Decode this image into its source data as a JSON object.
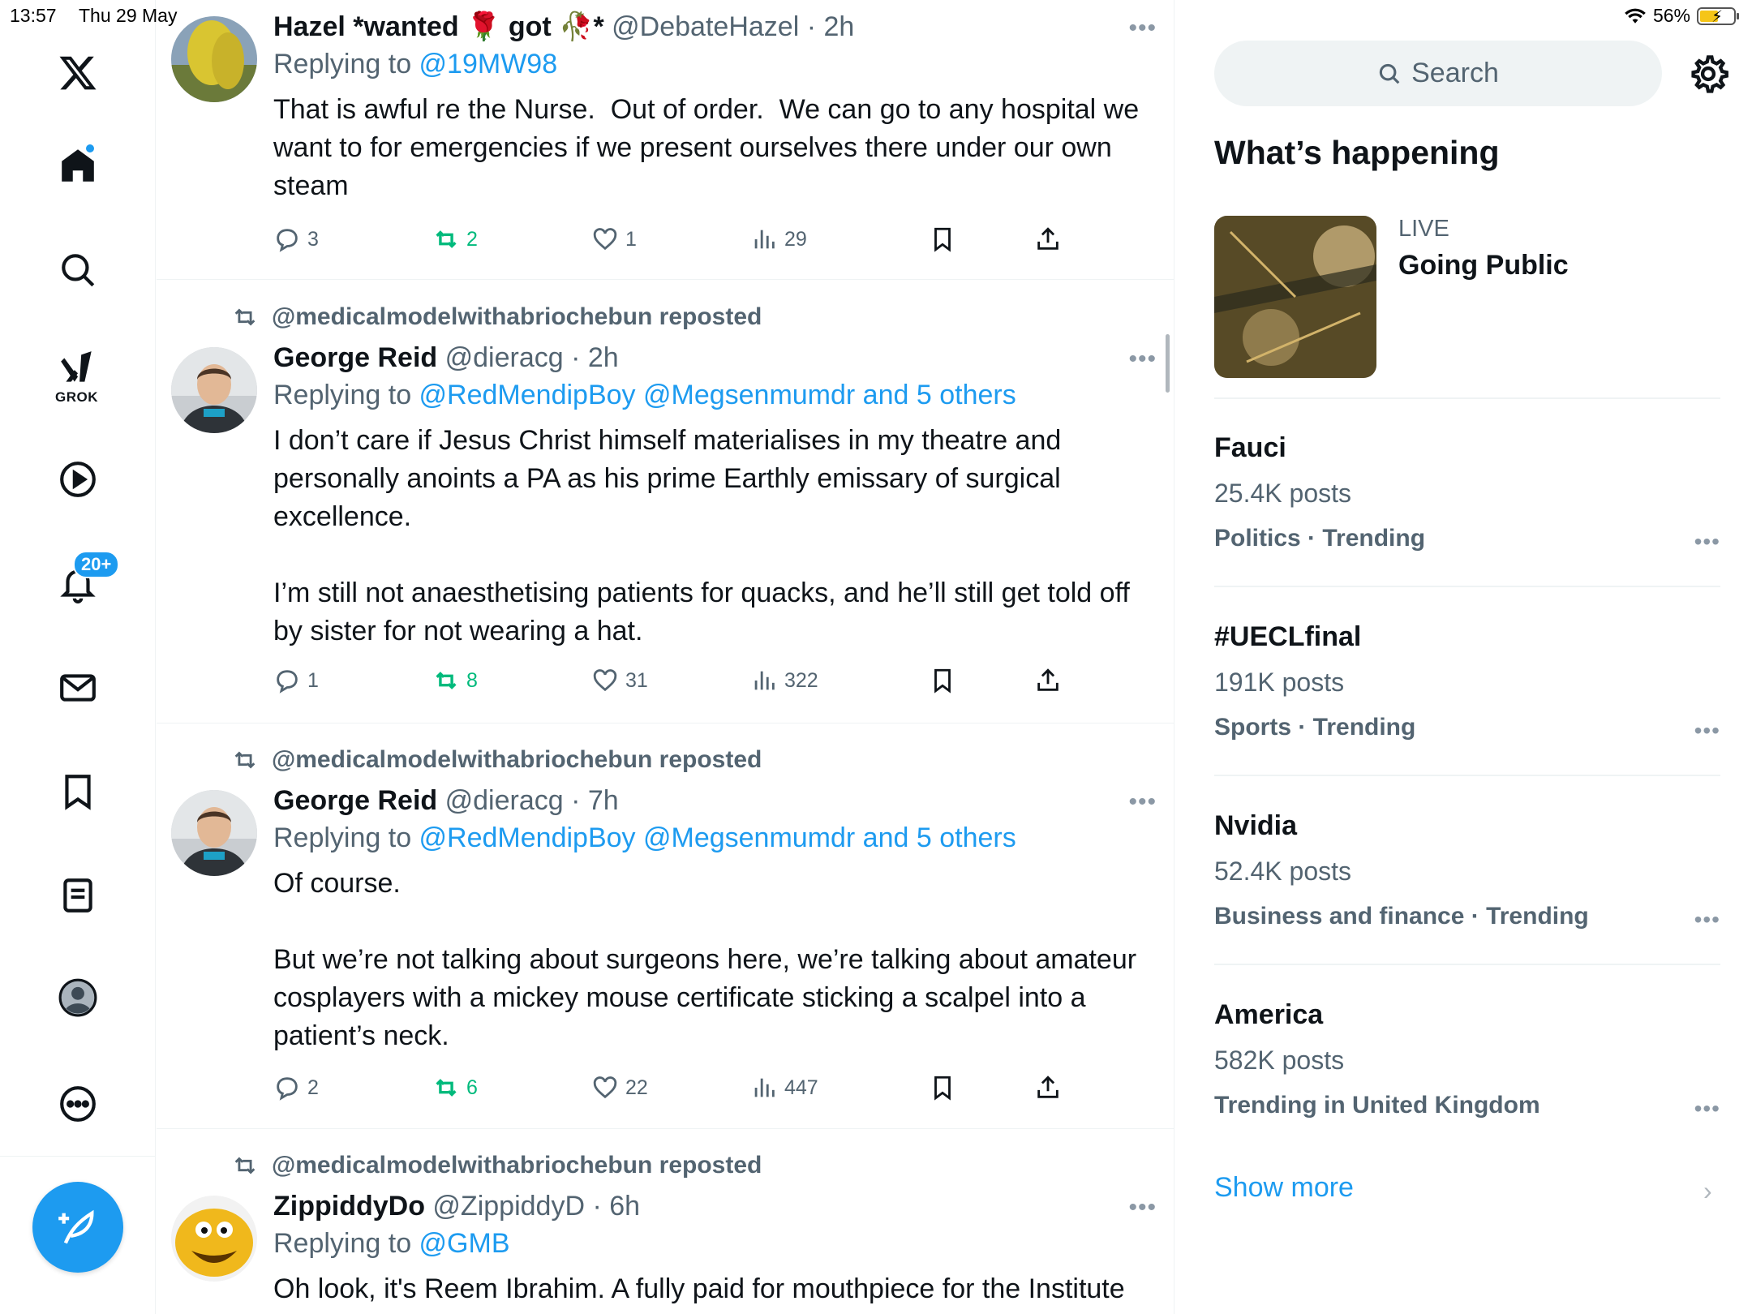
{
  "status_bar": {
    "time": "13:57",
    "date": "Thu 29 May",
    "battery": "56%"
  },
  "nav": {
    "grok_label": "GROK",
    "notifications_badge": "20+",
    "icons": [
      "x-logo-icon",
      "home-icon",
      "search-icon",
      "grok-icon",
      "video-icon",
      "notifications-icon",
      "messages-icon",
      "bookmarks-icon",
      "lists-icon",
      "profile-icon",
      "more-icon",
      "compose-icon"
    ]
  },
  "tweets": [
    {
      "repost_by": "",
      "name": "Hazel *wanted 🌹 got 🥀*",
      "handle": "@DebateHazel",
      "time": "2h",
      "reply_prefix": "Replying to ",
      "reply_to": "@19MW98",
      "text": "That is awful re the Nurse.  Out of order.  We can go to any hospital we want to for emergencies if we present ourselves there under our own steam",
      "replies": "3",
      "reposts": "2",
      "likes": "1",
      "views": "29"
    },
    {
      "repost_by": "@medicalmodelwithabriochebun reposted",
      "name": "George Reid",
      "handle": "@dieracg",
      "time": "2h",
      "reply_prefix": "Replying to ",
      "reply_to": "@RedMendipBoy @Megsenmumdr and 5 others",
      "text": "I don’t care if Jesus Christ himself materialises in my theatre and personally anoints a PA as his prime Earthly emissary of surgical excellence.\n\nI’m still not anaesthetising patients for quacks, and he’ll still get told off by sister for not wearing a hat.",
      "replies": "1",
      "reposts": "8",
      "likes": "31",
      "views": "322"
    },
    {
      "repost_by": "@medicalmodelwithabriochebun reposted",
      "name": "George Reid",
      "handle": "@dieracg",
      "time": "7h",
      "reply_prefix": "Replying to ",
      "reply_to": "@RedMendipBoy @Megsenmumdr and 5 others",
      "text": "Of course.\n\nBut we’re not talking about surgeons here, we’re talking about amateur cosplayers with a mickey mouse certificate sticking a scalpel into a patient’s neck.",
      "replies": "2",
      "reposts": "6",
      "likes": "22",
      "views": "447"
    },
    {
      "repost_by": "@medicalmodelwithabriochebun reposted",
      "name": "ZippiddyDo",
      "handle": "@ZippiddyD",
      "time": "6h",
      "reply_prefix": "Replying to ",
      "reply_to": "@GMB",
      "text": "Oh look, it's Reem Ibrahim. A fully paid for mouthpiece for the Institute"
    }
  ],
  "sidebar": {
    "search_placeholder": "Search",
    "whats_happening": "What’s happening",
    "live": {
      "label": "LIVE",
      "title": "Going Public"
    },
    "trends": [
      {
        "topic": "Fauci",
        "count": "25.4K posts",
        "category": "Politics · Trending"
      },
      {
        "topic": "#UECLfinal",
        "count": "191K posts",
        "category": "Sports · Trending"
      },
      {
        "topic": "Nvidia",
        "count": "52.4K posts",
        "category": "Business and finance · Trending"
      },
      {
        "topic": "America",
        "count": "582K posts",
        "category": "Trending in United Kingdom"
      }
    ],
    "show_more": "Show more"
  },
  "colors": {
    "accent": "#1d9bf0",
    "repost_green": "#00ba7c",
    "secondary_text": "#536471"
  }
}
